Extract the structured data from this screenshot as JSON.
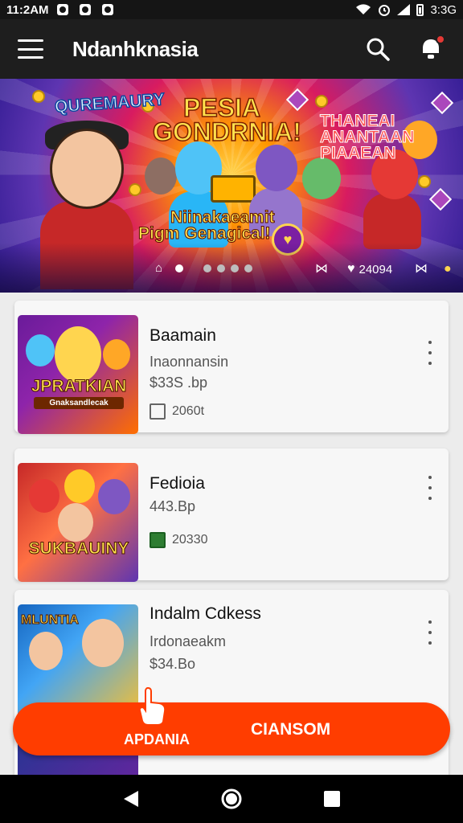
{
  "status_bar": {
    "time": "11:2AM",
    "battery": "3:3G"
  },
  "app_bar": {
    "title": "Ndanhknasia"
  },
  "banner": {
    "badge_text": "QUREMAURY",
    "headline_1": "PESIA",
    "headline_2": "GONDRNIA!",
    "right_1": "THANEAI",
    "right_2": "ANANTAAN",
    "right_3": "PIAAEAN",
    "bottom_1": "Niinakaeamit",
    "bottom_2": "Pigm Genagical!",
    "count": "24094",
    "total_dots": 5,
    "active_dot": 0
  },
  "products": [
    {
      "title": "Baamain",
      "subtitle": "Inaonnansin",
      "price": "$33S .bp",
      "meta": "2060t",
      "thumb_title": "JPRATKIAN",
      "thumb_sub": "Gnaksandlecak"
    },
    {
      "title": "Fedioia",
      "subtitle": "",
      "price": "443.Bp",
      "meta": "20330",
      "thumb_title": "SUKBAUINY",
      "thumb_sub": ""
    },
    {
      "title": "Indalm Cdkess",
      "subtitle": "Irdonaeakm",
      "price": "$34.Bo",
      "meta": "",
      "thumb_title": "MLUNTIA",
      "thumb_sub": ""
    }
  ],
  "action_bar": {
    "left_label": "APDANIA",
    "right_label": "CIANSOM"
  },
  "colors": {
    "accent": "#ff3d00",
    "app_bar": "#1e1e1e",
    "nav_bar": "#000000"
  }
}
